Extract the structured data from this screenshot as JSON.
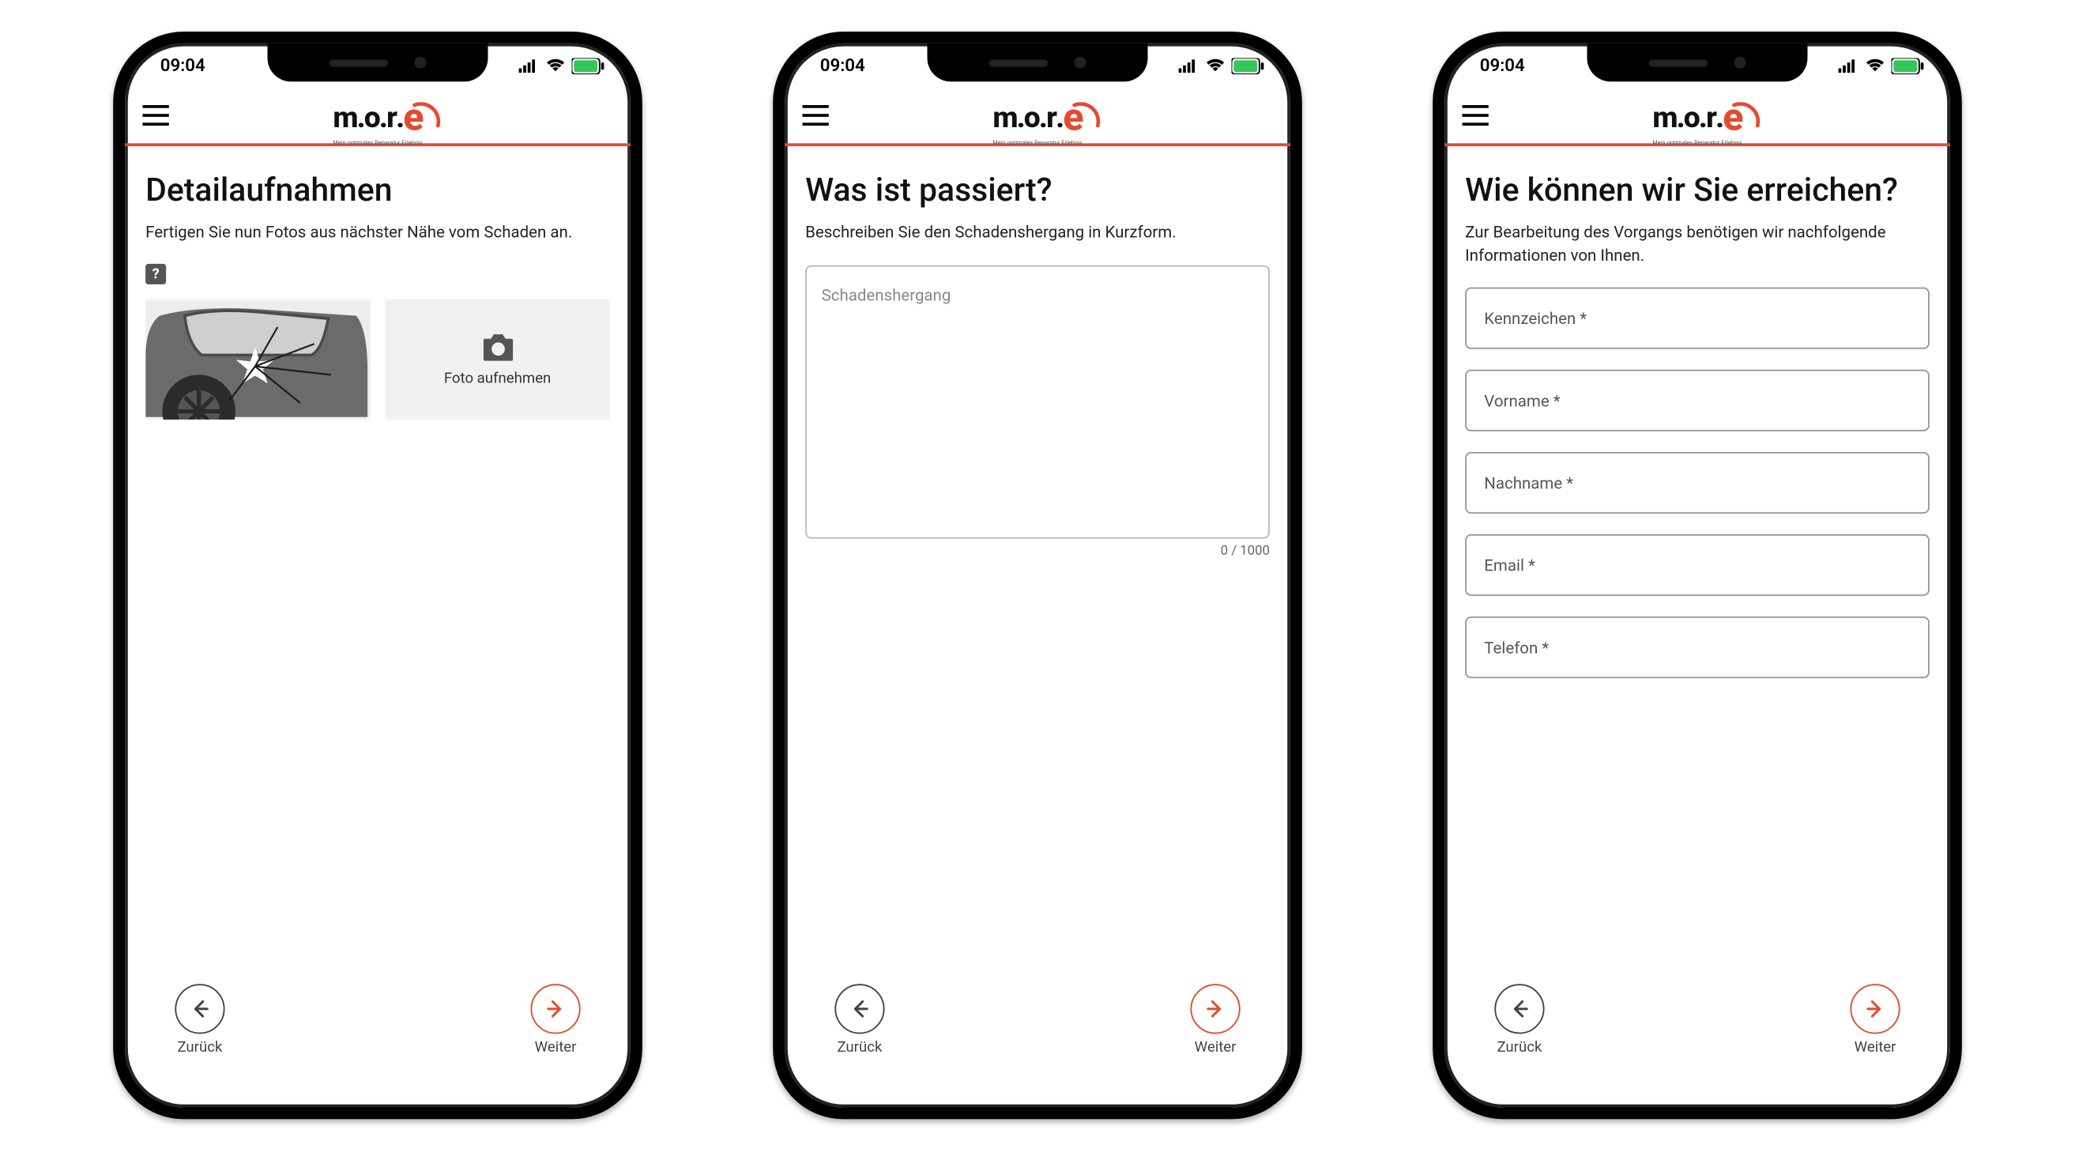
{
  "status": {
    "time": "09:04"
  },
  "logo": {
    "text_m": "m",
    "text_o1": "o",
    "text_r": "r",
    "text_e": "e",
    "dot": ".",
    "tagline": "Mein optimales Reparatur Erlebnis"
  },
  "nav": {
    "back": "Zurück",
    "next": "Weiter"
  },
  "help": {
    "symbol": "?"
  },
  "screen1": {
    "title": "Detailaufnahmen",
    "subtitle": "Fertigen Sie nun Fotos aus nächster Nähe vom Schaden an.",
    "take_photo": "Foto aufnehmen"
  },
  "screen2": {
    "title": "Was ist passiert?",
    "subtitle": "Beschreiben Sie den Schadenshergang in Kurzform.",
    "placeholder": "Schadenshergang",
    "char_count": "0 / 1000"
  },
  "screen3": {
    "title": "Wie können wir Sie erreichen?",
    "subtitle": "Zur Bearbeitung des Vorgangs benötigen wir nachfolgende Informationen von Ihnen.",
    "fields": {
      "kennzeichen": "Kennzeichen *",
      "vorname": "Vorname *",
      "nachname": "Nachname *",
      "email": "Email *",
      "telefon": "Telefon *"
    }
  }
}
